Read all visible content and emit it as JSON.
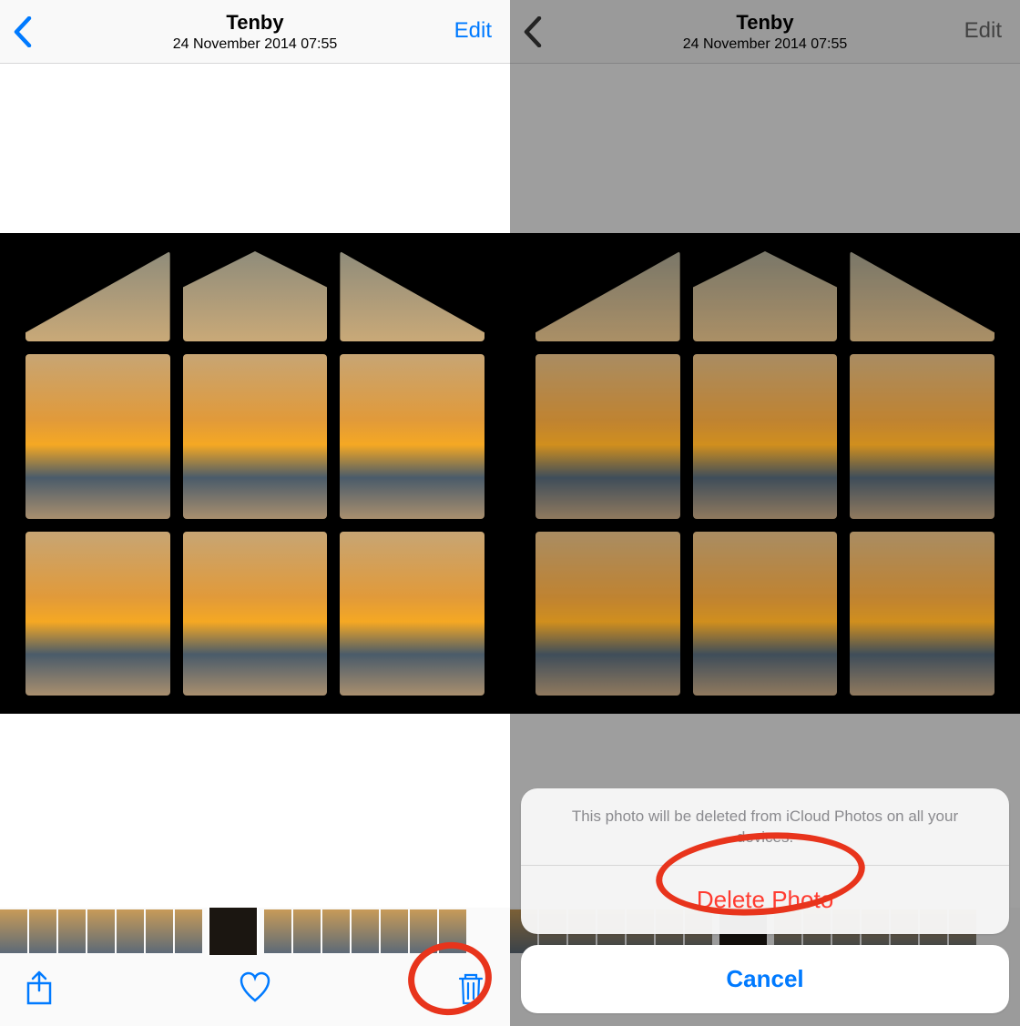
{
  "left": {
    "header": {
      "title": "Tenby",
      "subtitle": "24 November 2014  07:55",
      "edit": "Edit"
    }
  },
  "right": {
    "header": {
      "title": "Tenby",
      "subtitle": "24 November 2014  07:55",
      "edit": "Edit"
    },
    "sheet": {
      "message": "This photo will be deleted from iCloud Photos on all your devices.",
      "delete": "Delete Photo",
      "cancel": "Cancel"
    }
  },
  "colors": {
    "accent": "#007aff",
    "destructive": "#ff3b30"
  }
}
